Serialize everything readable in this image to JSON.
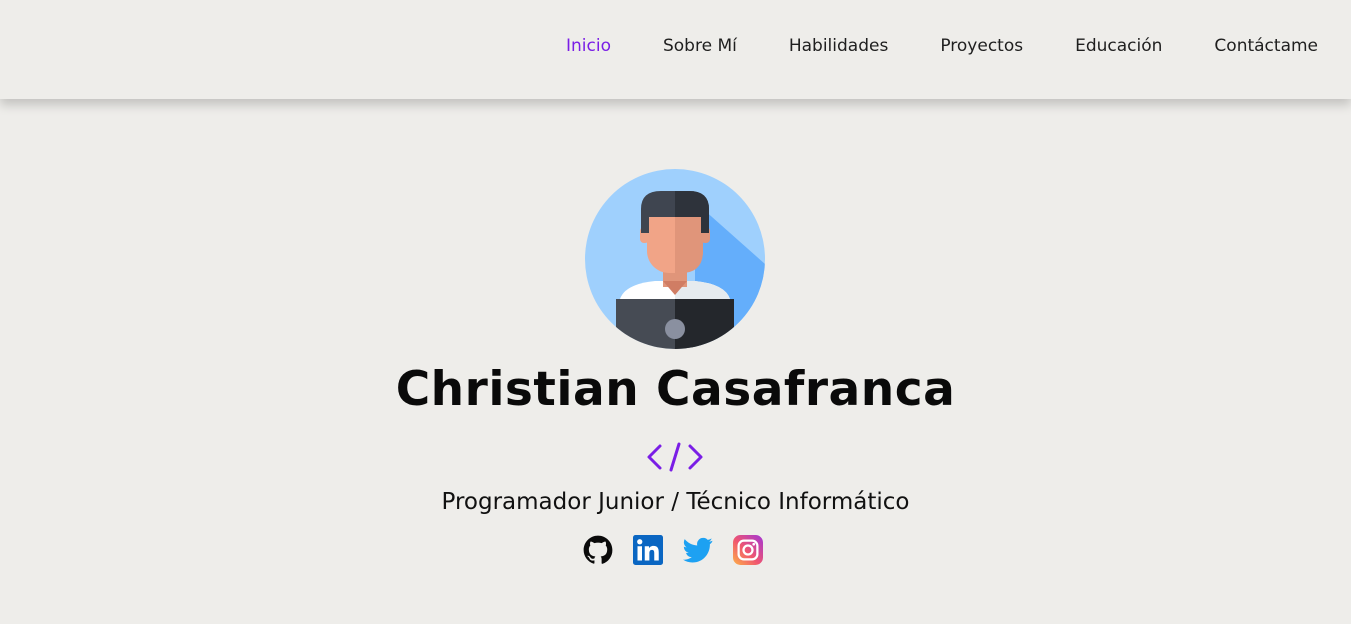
{
  "nav": {
    "items": [
      {
        "label": "Inicio",
        "active": true
      },
      {
        "label": "Sobre Mí",
        "active": false
      },
      {
        "label": "Habilidades",
        "active": false
      },
      {
        "label": "Proyectos",
        "active": false
      },
      {
        "label": "Educación",
        "active": false
      },
      {
        "label": "Contáctame",
        "active": false
      }
    ]
  },
  "hero": {
    "name": "Christian Casafranca",
    "role": "Programador Junior / Técnico Informático",
    "code_symbol_icon": "code-brackets-icon",
    "social": [
      {
        "icon": "github-icon"
      },
      {
        "icon": "linkedin-icon"
      },
      {
        "icon": "twitter-icon"
      },
      {
        "icon": "instagram-icon"
      }
    ]
  },
  "colors": {
    "accent": "#7a1ee6",
    "background": "#eeedea",
    "linkedin": "#0a66c2",
    "twitter": "#1da1f2"
  }
}
